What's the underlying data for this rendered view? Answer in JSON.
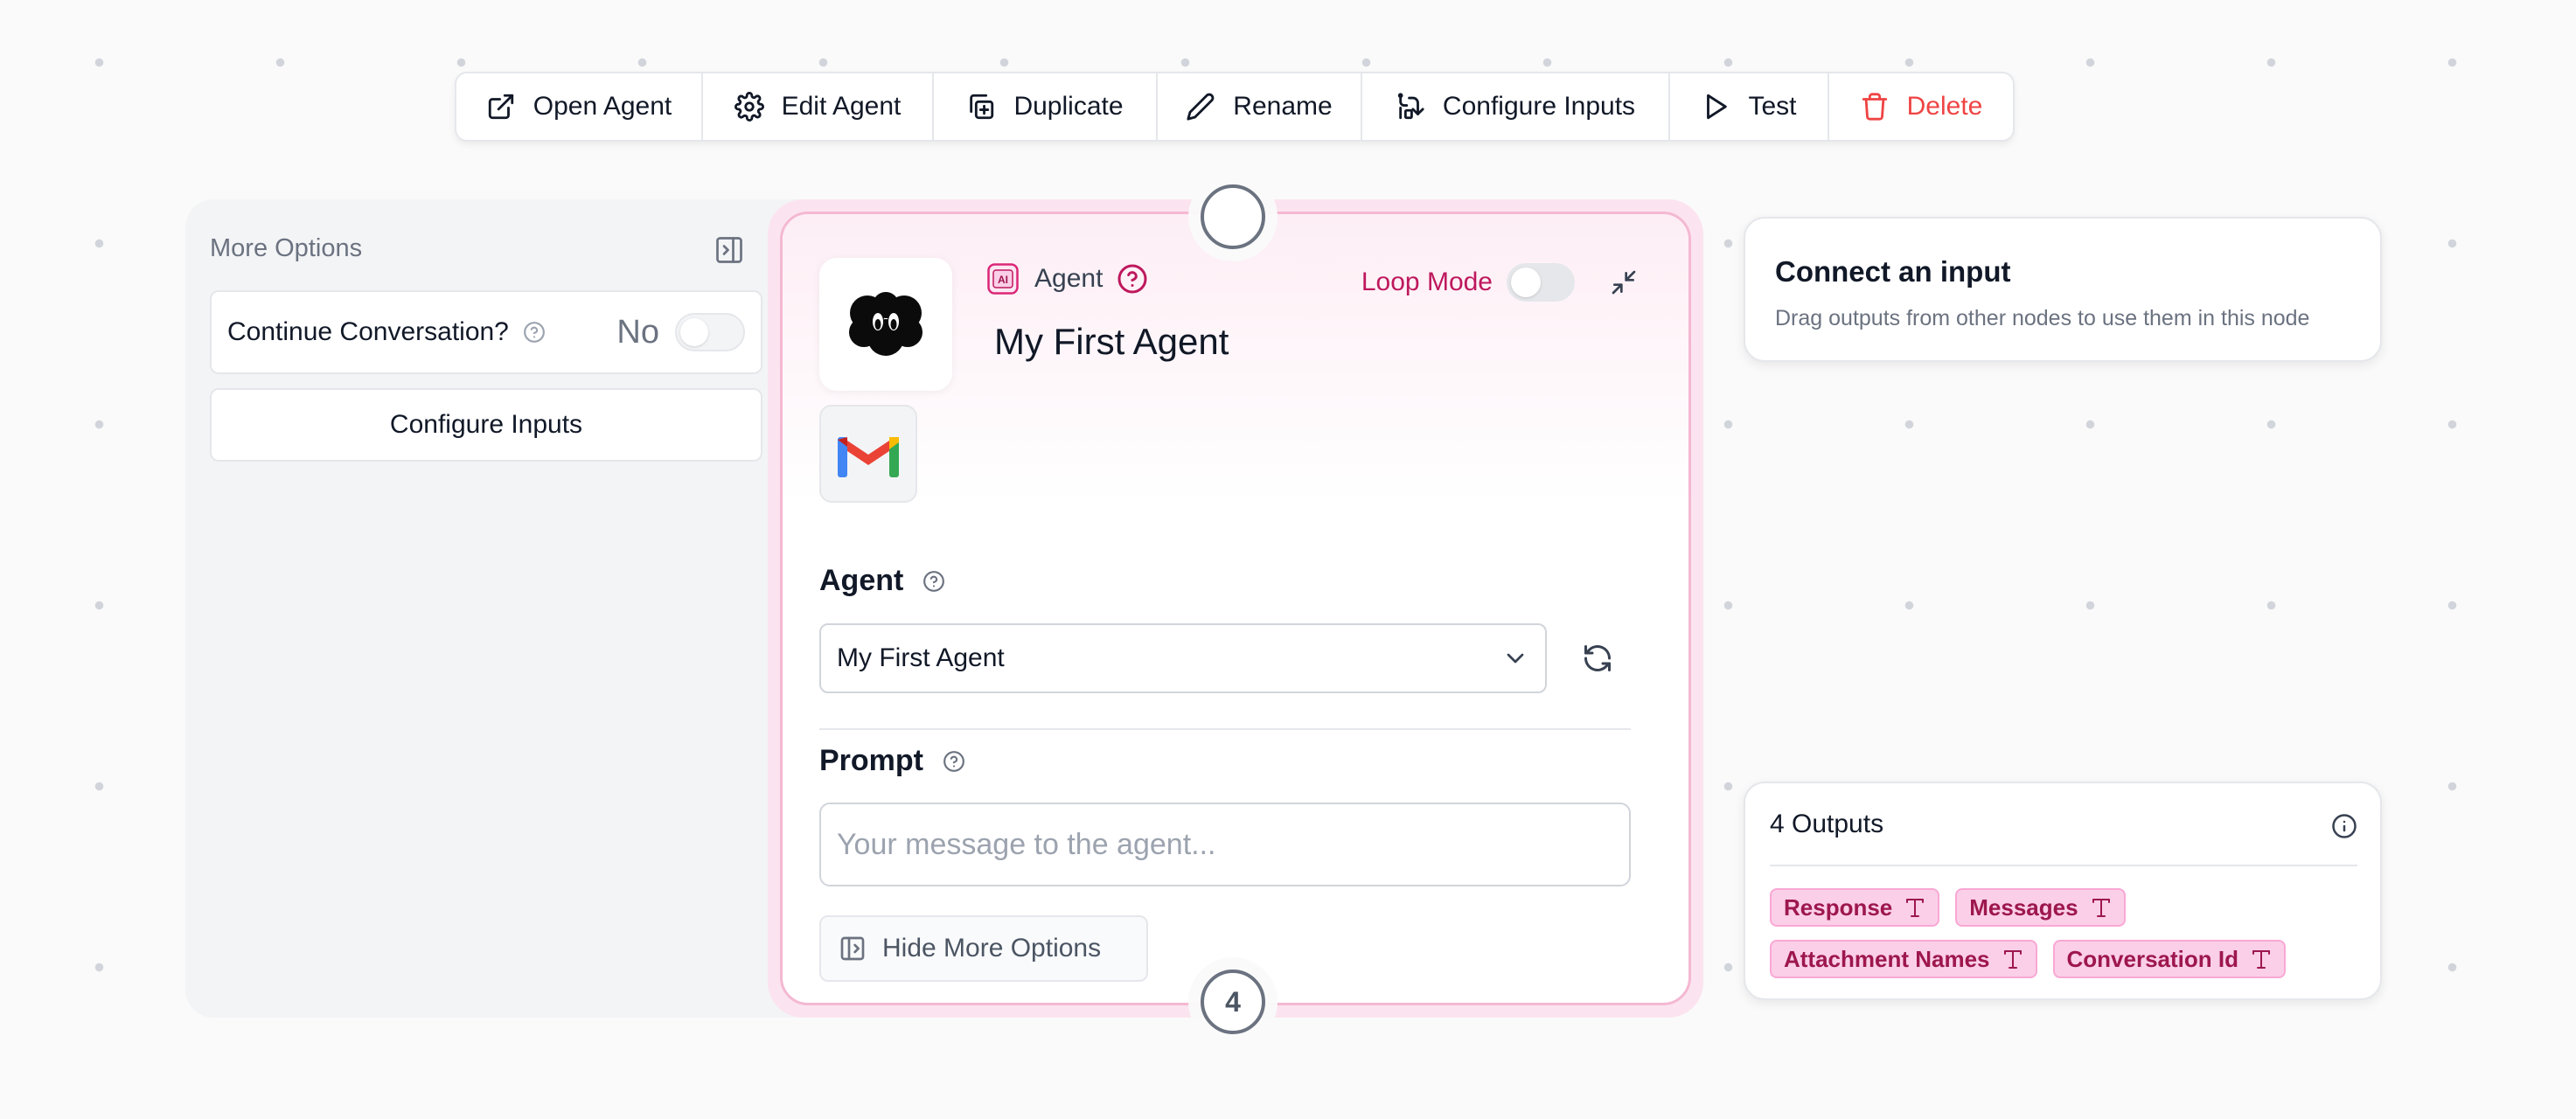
{
  "toolbar": {
    "items": [
      {
        "label": "Open Agent",
        "icon": "external-link-icon"
      },
      {
        "label": "Edit Agent",
        "icon": "gear-icon"
      },
      {
        "label": "Duplicate",
        "icon": "duplicate-icon"
      },
      {
        "label": "Rename",
        "icon": "pencil-icon"
      },
      {
        "label": "Configure Inputs",
        "icon": "configure-inputs-icon"
      },
      {
        "label": "Test",
        "icon": "play-icon"
      },
      {
        "label": "Delete",
        "icon": "trash-icon"
      }
    ],
    "danger_color": "#ef4444"
  },
  "more_options": {
    "title": "More Options",
    "continue_label": "Continue Conversation?",
    "continue_value": "No",
    "configure_label": "Configure Inputs"
  },
  "node": {
    "type_label": "Agent",
    "type_badge": "AI",
    "name": "My First Agent",
    "loop_label": "Loop Mode",
    "agent_section_label": "Agent",
    "agent_selected": "My First Agent",
    "prompt_section_label": "Prompt",
    "prompt_placeholder": "Your message to the agent...",
    "hide_options_label": "Hide More Options",
    "output_handle_count": "4",
    "accent_color": "#be185d"
  },
  "connect": {
    "title": "Connect an input",
    "description": "Drag outputs from other nodes to use them in this node"
  },
  "outputs": {
    "title": "4 Outputs",
    "items": [
      "Response",
      "Messages",
      "Attachment Names",
      "Conversation Id"
    ]
  }
}
